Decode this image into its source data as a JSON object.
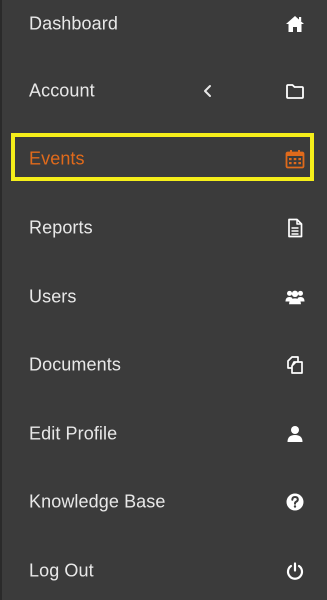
{
  "menu": {
    "items": [
      {
        "label": "Dashboard",
        "icon": "home-icon"
      },
      {
        "label": "Account",
        "icon": "folder-icon",
        "has_submenu": true
      },
      {
        "label": "Events",
        "icon": "calendar-icon",
        "active": true
      },
      {
        "label": "Reports",
        "icon": "document-icon"
      },
      {
        "label": "Users",
        "icon": "users-icon"
      },
      {
        "label": "Documents",
        "icon": "copy-icon"
      },
      {
        "label": "Edit Profile",
        "icon": "user-icon"
      },
      {
        "label": "Knowledge Base",
        "icon": "question-circle-icon"
      },
      {
        "label": "Log Out",
        "icon": "power-icon"
      }
    ]
  },
  "colors": {
    "background": "#3b3b3b",
    "text": "#e8e8e8",
    "active": "#e06a1b",
    "highlight_border": "#f5ee1a"
  }
}
